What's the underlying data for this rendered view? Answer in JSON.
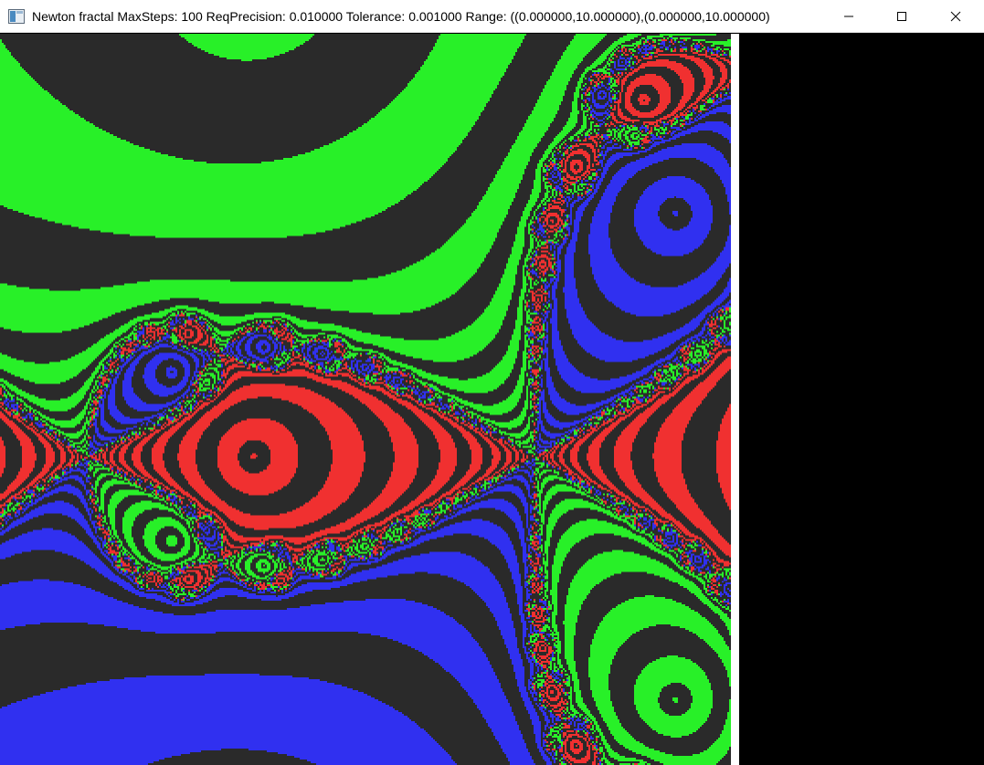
{
  "window": {
    "title": "Newton fractal MaxSteps: 100 ReqPrecision: 0.010000 Tolerance: 0.001000 Range: ((0.000000,10.000000),(0.000000,10.000000)",
    "icon": "app-window-icon",
    "controls": {
      "minimize": "minimize-icon",
      "maximize": "maximize-icon",
      "close": "close-icon"
    }
  },
  "fractal": {
    "type": "newton-fractal",
    "max_steps": 100,
    "req_precision": 0.01,
    "tolerance": 0.001,
    "range_x": [
      0,
      10
    ],
    "range_y": [
      0,
      10
    ],
    "colors": {
      "root_red": "#f03030",
      "root_green": "#28f028",
      "root_blue": "#3030f0",
      "band_dark": "#2a2a2a",
      "background": "#000000",
      "separator": "#ffffff"
    }
  }
}
